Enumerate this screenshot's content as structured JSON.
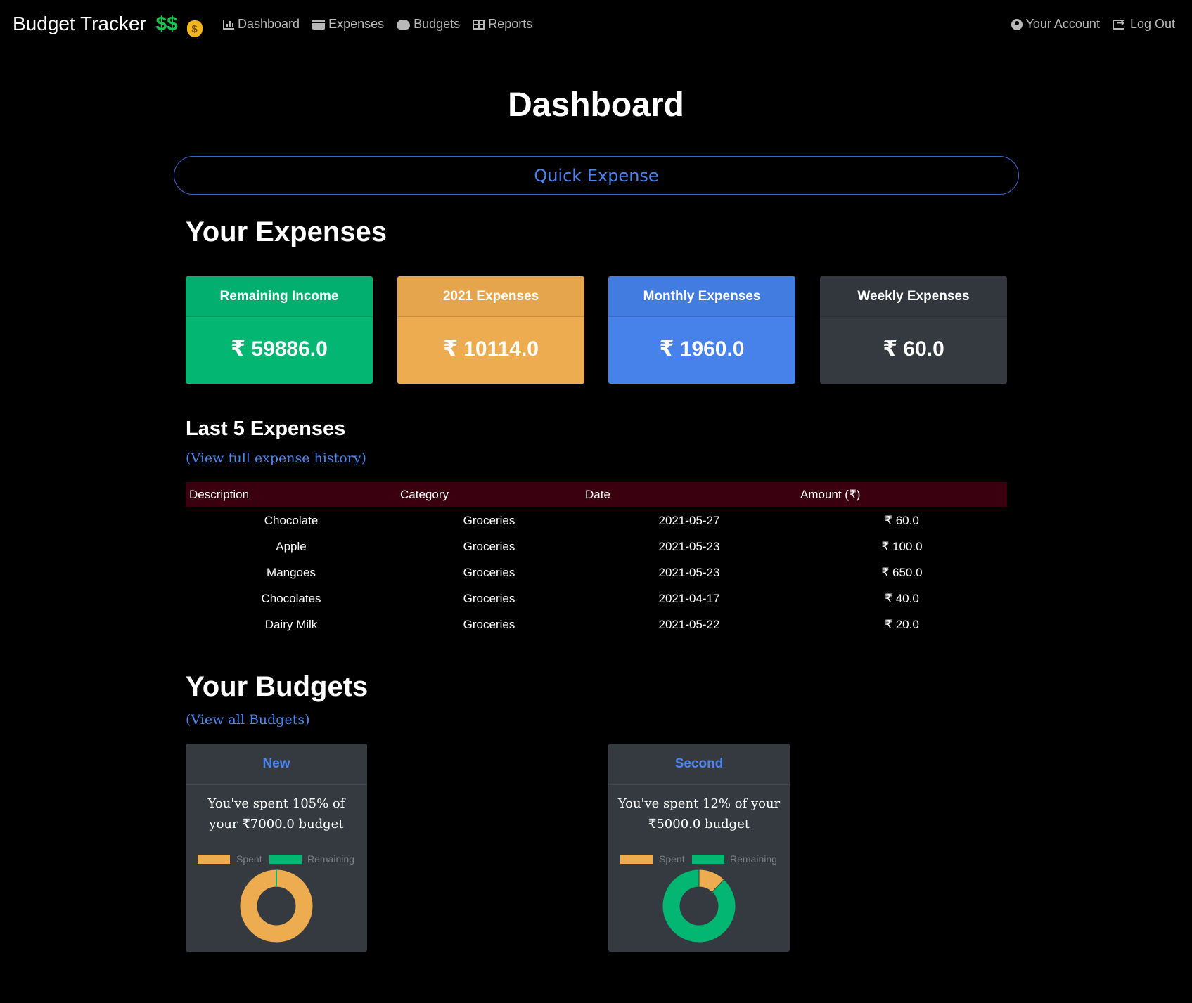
{
  "navbar": {
    "brand": "Budget Tracker",
    "brand_symbols": "$$",
    "colors": {
      "brand_symbol": "#19c24f"
    },
    "links": [
      {
        "icon": "bar-chart-icon",
        "label": "Dashboard"
      },
      {
        "icon": "wallet-icon",
        "label": "Expenses"
      },
      {
        "icon": "piggy-bank-icon",
        "label": "Budgets"
      },
      {
        "icon": "table-icon",
        "label": "Reports"
      }
    ],
    "account": {
      "icon": "user-circle-icon",
      "label": "Your Account"
    },
    "logout": {
      "icon": "logout-icon",
      "label": "Log Out"
    }
  },
  "page": {
    "title": "Dashboard",
    "quick_expense_label": "Quick Expense"
  },
  "expenses": {
    "title": "Your Expenses",
    "cards": [
      {
        "label": "Remaining Income",
        "value": "₹ 59886.0",
        "color": "#03b773"
      },
      {
        "label": "2021 Expenses",
        "value": "₹ 10114.0",
        "color": "#eeac50"
      },
      {
        "label": "Monthly Expenses",
        "value": "₹ 1960.0",
        "color": "#4682ea"
      },
      {
        "label": "Weekly Expenses",
        "value": "₹ 60.0",
        "color": "#343a40"
      }
    ]
  },
  "last_expenses": {
    "title": "Last 5 Expenses",
    "link": "(View full expense history)",
    "columns": [
      "Description",
      "Category",
      "Date",
      "Amount (₹)"
    ],
    "rows": [
      [
        "Chocolate",
        "Groceries",
        "2021-05-27",
        "₹ 60.0"
      ],
      [
        "Apple",
        "Groceries",
        "2021-05-23",
        "₹ 100.0"
      ],
      [
        "Mangoes",
        "Groceries",
        "2021-05-23",
        "₹ 650.0"
      ],
      [
        "Chocolates",
        "Groceries",
        "2021-04-17",
        "₹ 40.0"
      ],
      [
        "Dairy Milk",
        "Groceries",
        "2021-05-22",
        "₹ 20.0"
      ]
    ]
  },
  "budgets": {
    "title": "Your Budgets",
    "link": "(View all Budgets)",
    "legend": {
      "spent": "Spent",
      "remaining": "Remaining"
    },
    "colors": {
      "spent": "#eeac50",
      "remaining": "#03b773"
    },
    "items": [
      {
        "name": "New",
        "text": "You've spent 105% of your ₹7000.0 budget",
        "spent_fraction": 1.0,
        "remaining_fraction": 0.0
      },
      {
        "name": "Second",
        "text": "You've spent 12% of your ₹5000.0 budget",
        "spent_fraction": 0.12,
        "remaining_fraction": 0.88
      }
    ]
  }
}
